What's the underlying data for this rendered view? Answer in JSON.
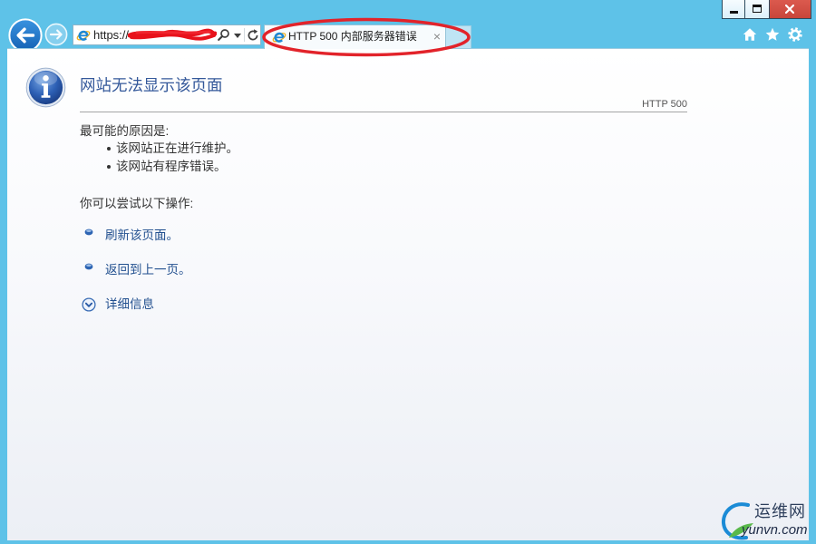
{
  "colors": {
    "frame": "#5ec2e8",
    "heading": "#34589a",
    "link": "#22508f",
    "close_button": "#c8453b",
    "annotation": "#e2232a"
  },
  "window_controls": [
    "minimize-icon",
    "maximize-icon",
    "close-icon"
  ],
  "toolbar": {
    "back_icon": "arrow-left-icon",
    "forward_icon": "arrow-right-icon",
    "address": {
      "site_icon": "ie-icon",
      "value": "https://",
      "search_icon": "search-icon",
      "dropdown_icon": "chevron-down-icon",
      "refresh_icon": "refresh-icon"
    },
    "tab": {
      "icon": "ie-icon",
      "title": "HTTP 500 内部服务器错误",
      "close": "×"
    },
    "right_icons": [
      "home-icon",
      "star-icon",
      "gear-icon"
    ]
  },
  "page": {
    "icon": "info-icon",
    "title": "网站无法显示该页面",
    "status_code": "HTTP 500",
    "causes_heading": "最可能的原因是:",
    "causes": [
      "该网站正在进行维护。",
      "该网站有程序错误。"
    ],
    "actions_heading": "你可以尝试以下操作:",
    "actions": [
      "刷新该页面。",
      "返回到上一页。"
    ],
    "details_label": "详细信息"
  },
  "watermark": {
    "name": "运维网",
    "domain": "yunvn.com"
  }
}
